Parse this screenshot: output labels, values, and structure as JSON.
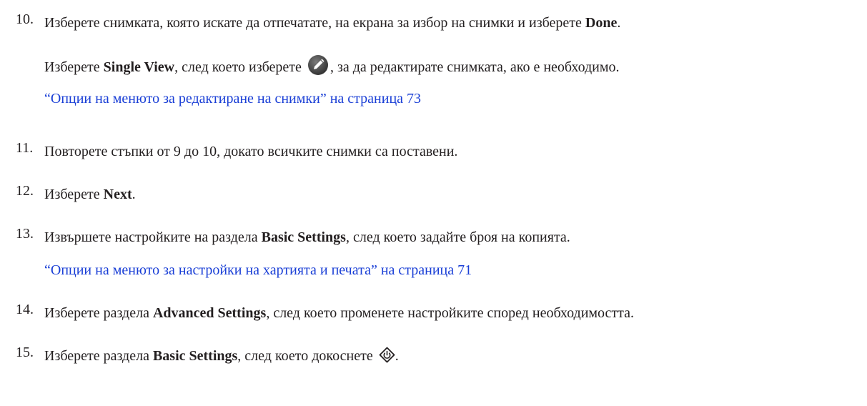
{
  "steps": [
    {
      "num": "10.",
      "lines": {
        "a": {
          "pre": "Изберете снимката, която искате да отпечатате, на екрана за избор на снимки и изберете ",
          "bold": "Done",
          "post": "."
        },
        "b": {
          "pre": "Изберете ",
          "bold": "Single View",
          "mid": ", след което изберете ",
          "post": ", за да редактирате снимката, ако е необходимо."
        },
        "link": "“Опции на менюто за редактиране на снимки” на страница 73"
      }
    },
    {
      "num": "11.",
      "text": "Повторете стъпки от 9 до 10, докато всичките снимки са поставени."
    },
    {
      "num": "12.",
      "pre": "Изберете ",
      "bold": "Next",
      "post": "."
    },
    {
      "num": "13.",
      "pre": "Извършете настройките на раздела ",
      "bold": "Basic Settings",
      "post": ", след което задайте броя на копията.",
      "link": "“Опции на менюто за настройки на хартията и печата” на страница 71"
    },
    {
      "num": "14.",
      "pre": "Изберете раздела ",
      "bold": "Advanced Settings",
      "post": ", след което променете настройките според необходимостта."
    },
    {
      "num": "15.",
      "pre": "Изберете раздела ",
      "bold": "Basic Settings",
      "post": ", след което докоснете ",
      "end": "."
    }
  ],
  "icons": {
    "edit": "pencil-edit-icon",
    "start": "start-diamond-icon",
    "link_color": "#1a3fd6"
  }
}
